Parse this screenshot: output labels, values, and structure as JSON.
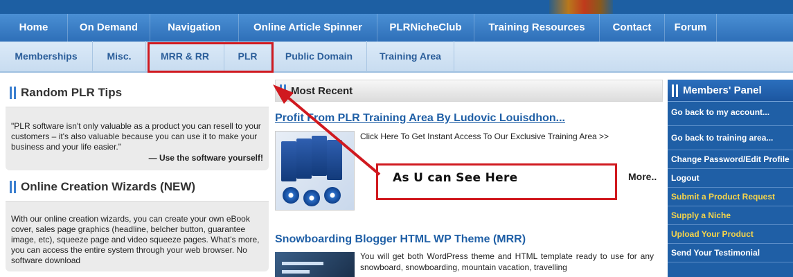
{
  "main_nav": [
    {
      "label": "Home"
    },
    {
      "label": "On Demand"
    },
    {
      "label": "Navigation"
    },
    {
      "label": "Online Article Spinner"
    },
    {
      "label": "PLRNicheClub"
    },
    {
      "label": "Training Resources"
    },
    {
      "label": "Contact"
    },
    {
      "label": "Forum"
    }
  ],
  "sub_nav": [
    {
      "label": "Memberships"
    },
    {
      "label": "Misc."
    },
    {
      "label": "MRR & RR"
    },
    {
      "label": "PLR"
    },
    {
      "label": "Public Domain"
    },
    {
      "label": "Training Area"
    }
  ],
  "left": {
    "tips_title": "Random PLR Tips",
    "tips_text": "\"PLR software isn't only valuable as a product you can resell to your customers – it's also valuable because you can use it to make your business and your life easier.\"",
    "tips_source": "— Use the software yourself!",
    "wizards_title": "Online Creation Wizards (NEW)",
    "wizards_text": "With our online creation wizards, you can create your own eBook cover, sales page graphics (headline, belcher button, guarantee image, etc), squeeze page and video squeeze pages. What's more, you can access the entire system through your web browser. No software download"
  },
  "middle": {
    "title": "Most Recent",
    "post1_title": "Profit From PLR Training Area By Ludovic Louisdhon...",
    "post1_text": "Click Here To Get Instant Access To Our Exclusive Training Area >>",
    "more_link": "More..",
    "callout": "As U can See Here",
    "post2_title": "Snowboarding Blogger HTML WP Theme (MRR)",
    "post2_text": "You will get both WordPress theme and HTML template ready to use for any snowboard, snowboarding, mountain vacation, travelling"
  },
  "members": {
    "title": "Members' Panel",
    "links": [
      {
        "label": "Go back to my account..."
      },
      {
        "label": "Go back to training area..."
      },
      {
        "label": "Change Password/Edit Profile"
      },
      {
        "label": "Logout"
      },
      {
        "label": "Submit a Product Request"
      },
      {
        "label": "Supply a Niche"
      },
      {
        "label": "Upload Your Product"
      },
      {
        "label": "Send Your Testimonial"
      }
    ]
  },
  "colors": {
    "highlight_red": "#d0191f",
    "nav_blue": "#2e6fb8",
    "link_blue": "#1f5fa6",
    "panel_yellow": "#f7d54a"
  }
}
